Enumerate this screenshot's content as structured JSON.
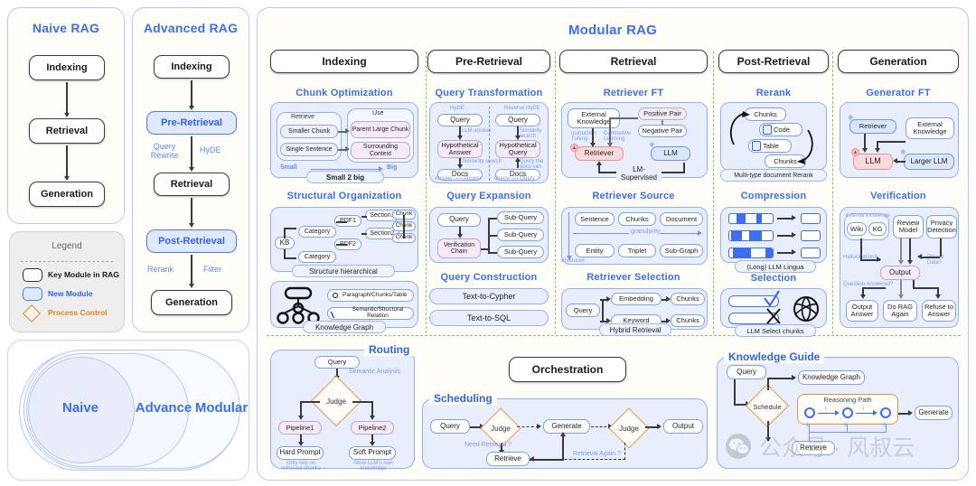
{
  "paradigms": {
    "naive": {
      "title": "Naive RAG",
      "steps": [
        "Indexing",
        "Retrieval",
        "Generation"
      ]
    },
    "advanced": {
      "title": "Advanced RAG",
      "steps": [
        "Indexing",
        "Pre-Retrieval",
        "Retrieval",
        "Post-Retrieval",
        "Generation"
      ],
      "edge_labels": [
        "Query Rewrite",
        "HyDE",
        "Rerank",
        "Filter"
      ]
    }
  },
  "legend": {
    "title": "Legend",
    "items": [
      {
        "label": "Key Module in RAG",
        "swatch": "key-module",
        "color": "#1a1a1a"
      },
      {
        "label": "New Module",
        "swatch": "new-module",
        "color": "#2f63e8"
      },
      {
        "label": "Process Control",
        "swatch": "process-control",
        "color": "#e8821f"
      }
    ]
  },
  "venn": {
    "labels": [
      "Naive",
      "Advance",
      "Modular"
    ]
  },
  "modular": {
    "title": "Modular RAG",
    "stages": [
      {
        "name": "Indexing",
        "sections": [
          {
            "title": "Chunk Optimization",
            "caption": "Small 2 big",
            "groups": [
              {
                "header": "Retrieve",
                "items": [
                  "Smaller Chunk",
                  "Single Sentence"
                ]
              },
              {
                "header": "Use",
                "items": [
                  "Parent Large Chunk",
                  "Surrounding Context"
                ]
              }
            ],
            "axis": {
              "from": "Small",
              "to": "Big"
            }
          },
          {
            "title": "Structural Organization",
            "caption": "Structure hierarchical",
            "tree": [
              "KB",
              "Category",
              "Category",
              "PDF1",
              "PDF2",
              "Section1",
              "Section2",
              "Chunk",
              "Chunk",
              "Chunk"
            ]
          },
          {
            "title": "",
            "caption": "Knowledge Graph",
            "kg_legend": [
              "Paragraph/Chunks/Table",
              "Semantic/Structural Relation"
            ]
          }
        ]
      },
      {
        "name": "Pre-Retrieval",
        "sections": [
          {
            "title": "Query Transformation",
            "left": {
              "header": "HyDE",
              "nodes": [
                "Query",
                "Hypothetical Answer",
                "Docs"
              ],
              "edges": [
                "LLM answer",
                "Similarity search"
              ],
              "footer": "Answer ⟶ Answer"
            },
            "right": {
              "header": "Reverse HyDE",
              "nodes": [
                "Query",
                "Hypothetical Query",
                "Docs"
              ],
              "edges": [
                "Similarity search",
                "Query the docs can answer"
              ],
              "footer": "Query ⟶ Query"
            }
          },
          {
            "title": "Query Expansion",
            "nodes": [
              "Query",
              "Verification Chain"
            ],
            "subs": [
              "Sub-Query",
              "Sub-Query",
              "Sub-Query"
            ]
          },
          {
            "title": "Query Construction",
            "items": [
              "Text-to-Cypher",
              "Text-to-SQL"
            ]
          }
        ]
      },
      {
        "name": "Retrieval",
        "sections": [
          {
            "title": "Retriever FT",
            "nodes": [
              "External Knowledge",
              "Positive Pair",
              "Negative Pair",
              "Retriever",
              "LLM"
            ],
            "edges": [
              "Instruction Tuning",
              "Contrastive Learning",
              "LM-Supervised"
            ]
          },
          {
            "title": "Retriever Source",
            "row1": [
              "Sentence",
              "Chunks",
              "Document"
            ],
            "row2": [
              "Entity",
              "Triplet",
              "Sub-Graph"
            ],
            "axis_h": "granularity",
            "axis_v": "structured"
          },
          {
            "title": "Retriever Selection",
            "caption": "Hybrid Retrieval",
            "query": "Query",
            "paths": [
              [
                "Embedding",
                "Chunks"
              ],
              [
                "Keyword",
                "Chunks"
              ]
            ]
          }
        ]
      },
      {
        "name": "Post-Retrieval",
        "sections": [
          {
            "title": "Rerank",
            "caption": "Multi-type document Rerank",
            "items": [
              "Chunks",
              "Code",
              "Table",
              "Chunks"
            ]
          },
          {
            "title": "Compression",
            "caption": "(Long) LLM Lingua"
          },
          {
            "title": "Selection",
            "caption": "LLM Select chunks"
          }
        ]
      },
      {
        "name": "Generation",
        "sections": [
          {
            "title": "Generator FT",
            "nodes": [
              "Retriever",
              "External Knowledge",
              "LLM",
              "Larger LLM"
            ]
          },
          {
            "title": "Verification",
            "top": [
              "Wiki",
              "KG",
              "Review Model",
              "Privacy Detection"
            ],
            "top_group_label": "External Knowledge",
            "center": "Output",
            "bottom": [
              "Output Answer",
              "Do RAG Again",
              "Refuse to Answer"
            ],
            "edges": [
              "Hallucination?",
              "Private Data?",
              "Question Answered?"
            ]
          }
        ]
      }
    ],
    "bottom": {
      "routing": {
        "title": "Routing",
        "nodes": [
          "Query",
          "Judge",
          "Pipeline1",
          "Pipeline2",
          "Hard Prompt",
          "Soft Prompt"
        ],
        "edge_label": "Semantic Analysis",
        "notes": [
          "Only rely on retrieved chunks",
          "Allow LLM's own knowledge"
        ]
      },
      "orchestration": {
        "title": "Orchestration"
      },
      "scheduling": {
        "title": "Scheduling",
        "nodes": [
          "Query",
          "Judge",
          "Generate",
          "Judge",
          "Output",
          "Retrieve"
        ],
        "edges": [
          "Need Retrieval ?",
          "Retrieval Again ?"
        ]
      },
      "knowledge_guide": {
        "title": "Knowledge Guide",
        "nodes": [
          "Query",
          "Knowledge Graph",
          "Schedule",
          "Reasoning Path",
          "Generate",
          "Retrieve"
        ],
        "path_labels": [
          "r",
          "r"
        ],
        "step_marks": [
          "①",
          "②",
          "③"
        ]
      }
    }
  },
  "watermark": {
    "text": "公众号 · 风叔云"
  },
  "colors": {
    "accent": "#2f63e8",
    "panel_bg": "#fffdf7",
    "new_module": "#dfe8fd",
    "process_control": "#ef8f44",
    "divider": "#7fc08a"
  }
}
